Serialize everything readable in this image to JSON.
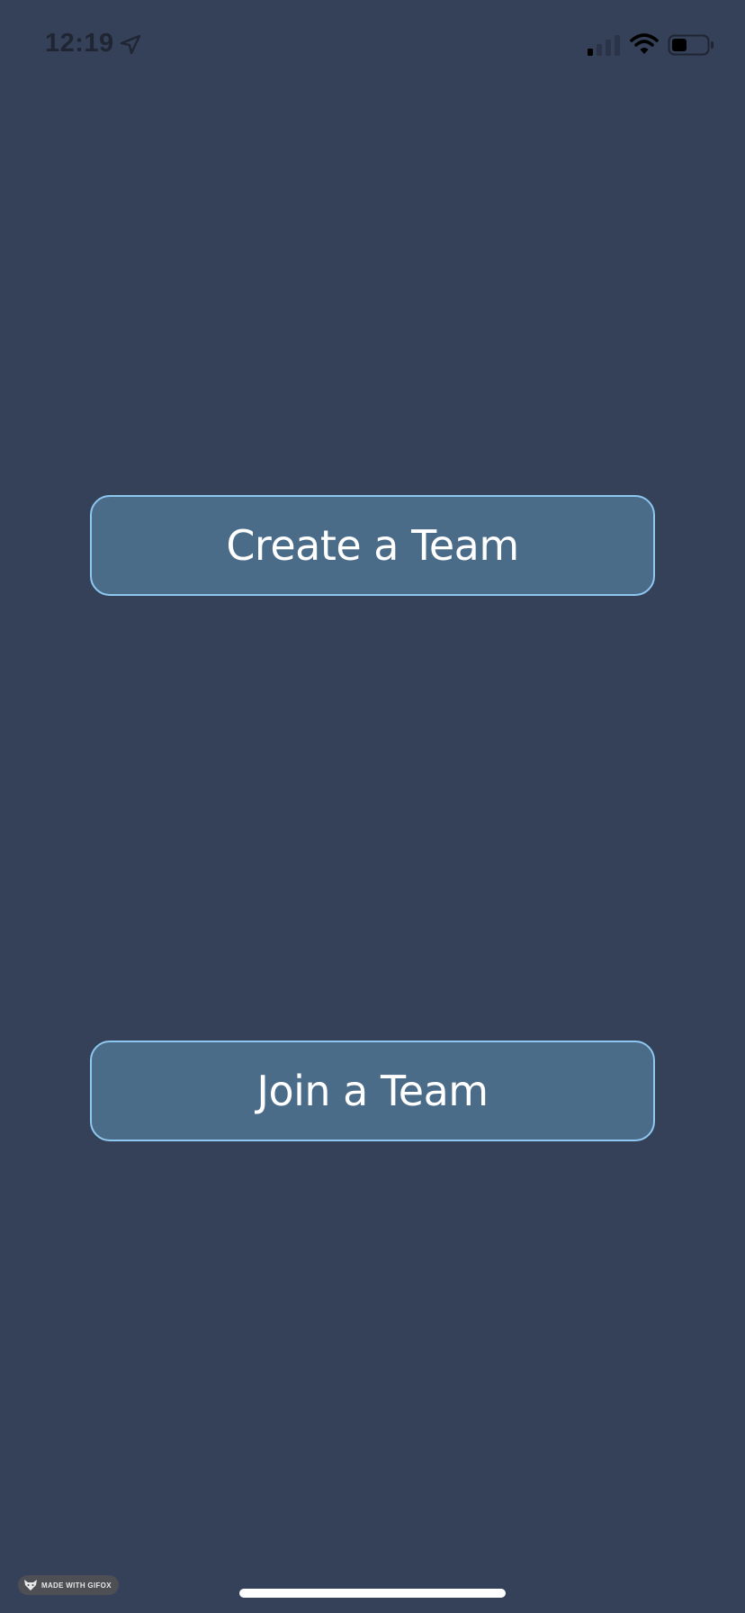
{
  "status_bar": {
    "time": "12:19",
    "icons": [
      "location-arrow-icon",
      "cellular-signal-icon",
      "wifi-icon",
      "battery-icon"
    ]
  },
  "buttons": {
    "create_label": "Create a Team",
    "join_label": "Join a Team"
  },
  "watermark": {
    "text": "MADE WITH GIFOX"
  },
  "colors": {
    "background": "#354158",
    "button_fill": "#4b6c89",
    "button_border": "#8ec8f0",
    "button_text": "#ffffff"
  }
}
